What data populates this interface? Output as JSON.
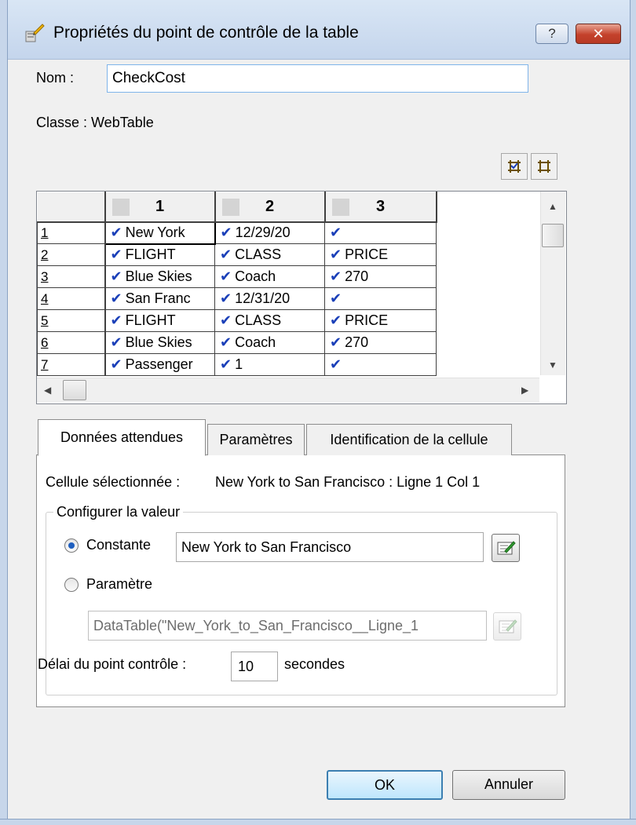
{
  "window": {
    "title": "Propriétés du point de contrôle de la table",
    "help_label": "?",
    "close_label": "✕"
  },
  "name_field": {
    "label": "Nom :",
    "value": "CheckCost"
  },
  "class_info": {
    "text": "Classe :  WebTable"
  },
  "grid": {
    "columns": [
      "1",
      "2",
      "3"
    ],
    "rows": [
      {
        "num": "1",
        "cells": [
          "New York",
          "12/29/20",
          ""
        ]
      },
      {
        "num": "2",
        "cells": [
          "FLIGHT",
          "CLASS",
          "PRICE"
        ]
      },
      {
        "num": "3",
        "cells": [
          "Blue Skies",
          "Coach",
          "270"
        ]
      },
      {
        "num": "4",
        "cells": [
          "San Franc",
          "12/31/20",
          ""
        ]
      },
      {
        "num": "5",
        "cells": [
          "FLIGHT",
          "CLASS",
          "PRICE"
        ]
      },
      {
        "num": "6",
        "cells": [
          "Blue Skies",
          "Coach",
          "270"
        ]
      },
      {
        "num": "7",
        "cells": [
          "Passenger",
          "1",
          ""
        ]
      }
    ]
  },
  "tabs": [
    {
      "label": "Données attendues",
      "active": true
    },
    {
      "label": "Paramètres",
      "active": false
    },
    {
      "label": "Identification de la cellule",
      "active": false
    }
  ],
  "selected_cell": {
    "label": "Cellule sélectionnée :",
    "value": "New York to San Francisco : Ligne 1 Col 1"
  },
  "configure": {
    "title": "Configurer la valeur",
    "constant_label": "Constante",
    "constant_value": "New York to San Francisco",
    "constant_selected": true,
    "parameter_label": "Paramètre",
    "parameter_value": "DataTable(\"New_York_to_San_Francisco__Ligne_1"
  },
  "timeout": {
    "label": "Délai du point contrôle :",
    "value": "10",
    "unit": "secondes"
  },
  "buttons": {
    "ok": "OK",
    "cancel": "Annuler"
  },
  "colors": {
    "check": "#1a3fb8",
    "radio_selected": "#1f5fbf",
    "ok_border": "#3c7fb1"
  }
}
